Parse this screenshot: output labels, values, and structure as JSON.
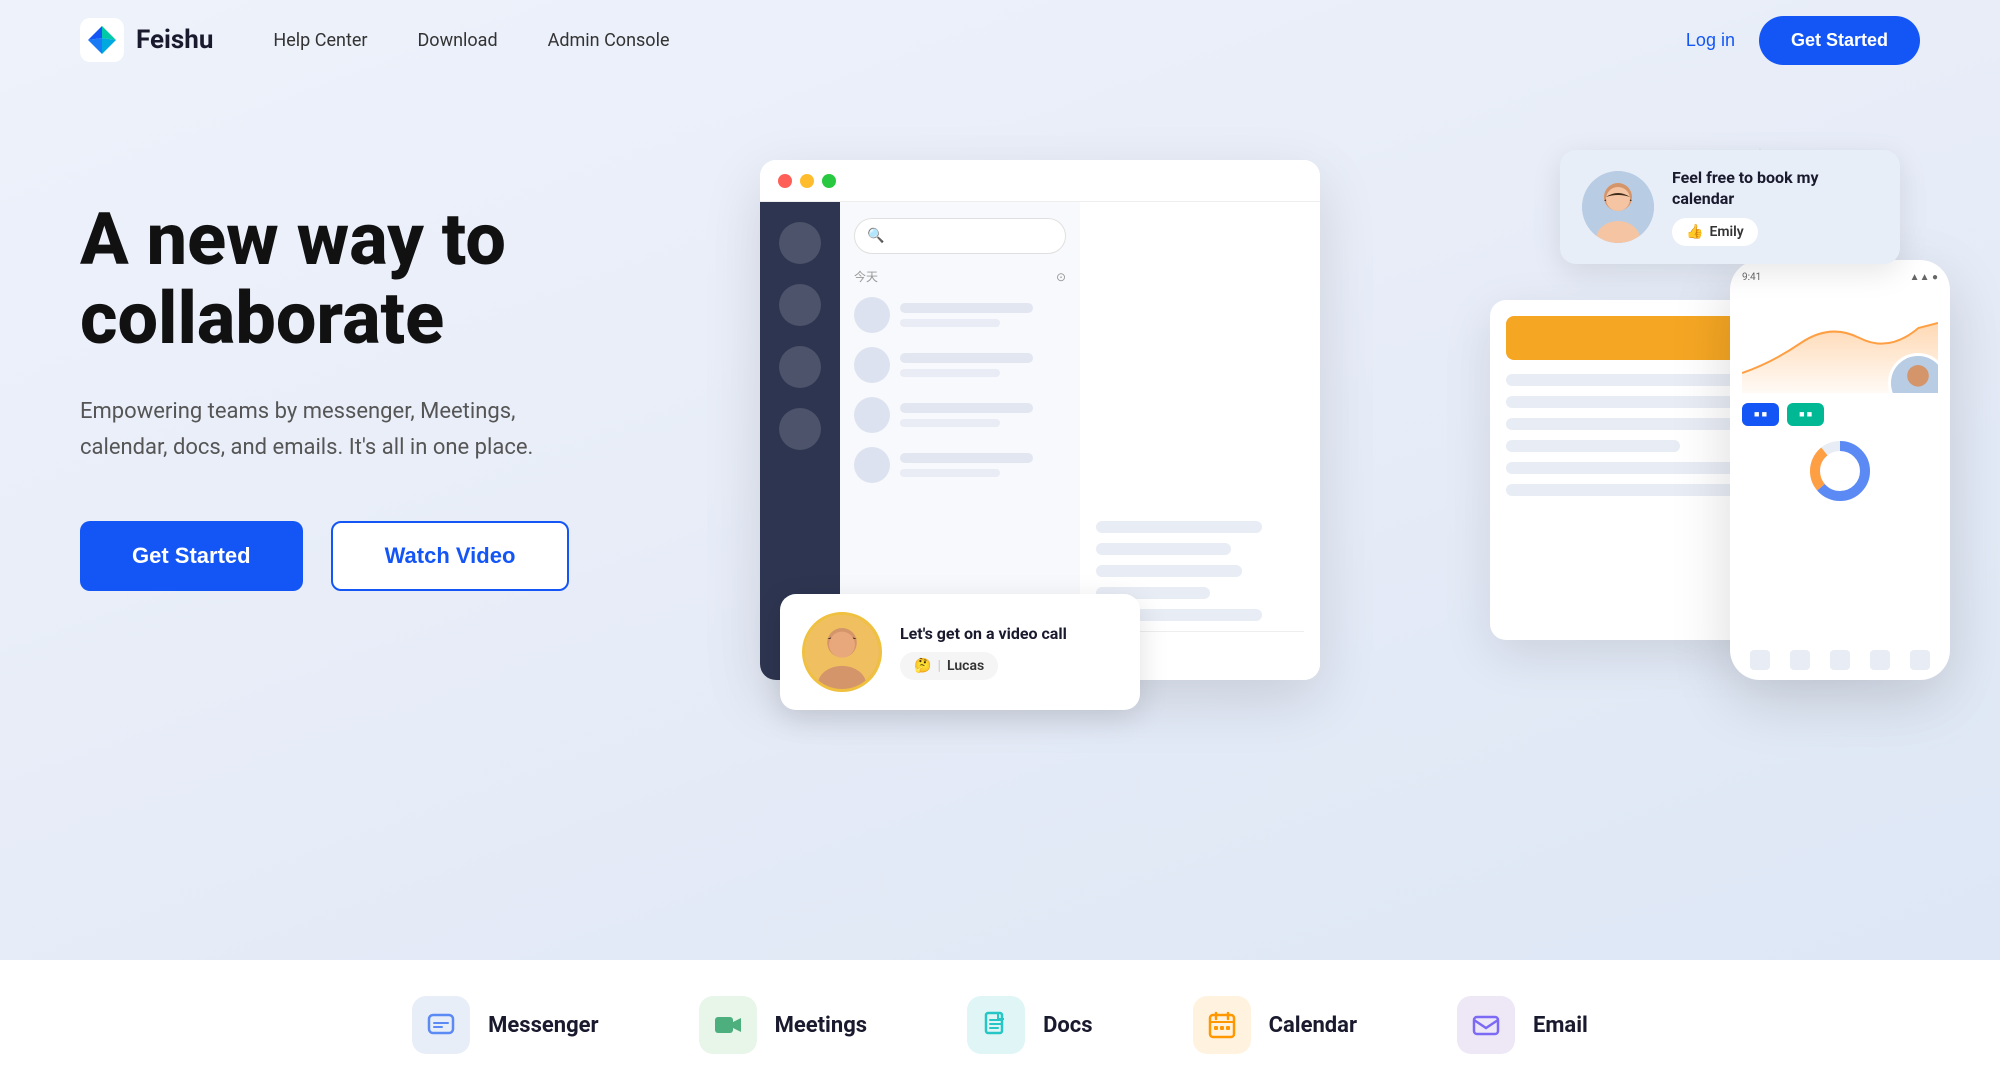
{
  "brand": {
    "name": "Feishu",
    "logo_alt": "Feishu logo"
  },
  "nav": {
    "items": [
      {
        "label": "Help Center",
        "id": "help-center"
      },
      {
        "label": "Download",
        "id": "download"
      },
      {
        "label": "Admin Console",
        "id": "admin-console"
      }
    ]
  },
  "header": {
    "login_label": "Log in",
    "get_started_label": "Get Started"
  },
  "hero": {
    "title": "A new way to collaborate",
    "subtitle": "Empowering teams by messenger, Meetings, calendar, docs, and emails. It's all in one place.",
    "get_started_label": "Get Started",
    "watch_video_label": "Watch Video"
  },
  "chat_bubbles": {
    "emily": {
      "message": "Feel free to book my calendar",
      "sender": "Emily",
      "emoji": "👍"
    },
    "lucas": {
      "message": "Let's get on a video call",
      "sender": "Lucas",
      "emoji": "🤔"
    }
  },
  "window": {
    "today_label": "今天",
    "search_placeholder": "Search"
  },
  "mobile": {
    "time": "9:41"
  },
  "features": [
    {
      "id": "messenger",
      "label": "Messenger",
      "icon_name": "chat-icon",
      "icon_color": "#5b8af5"
    },
    {
      "id": "meetings",
      "label": "Meetings",
      "icon_name": "video-icon",
      "icon_color": "#4caf7d"
    },
    {
      "id": "docs",
      "label": "Docs",
      "icon_name": "doc-icon",
      "icon_color": "#26c6c6"
    },
    {
      "id": "calendar",
      "label": "Calendar",
      "icon_name": "calendar-icon",
      "icon_color": "#ff9800"
    },
    {
      "id": "email",
      "label": "Email",
      "icon_name": "email-icon",
      "icon_color": "#7c6af5"
    }
  ]
}
